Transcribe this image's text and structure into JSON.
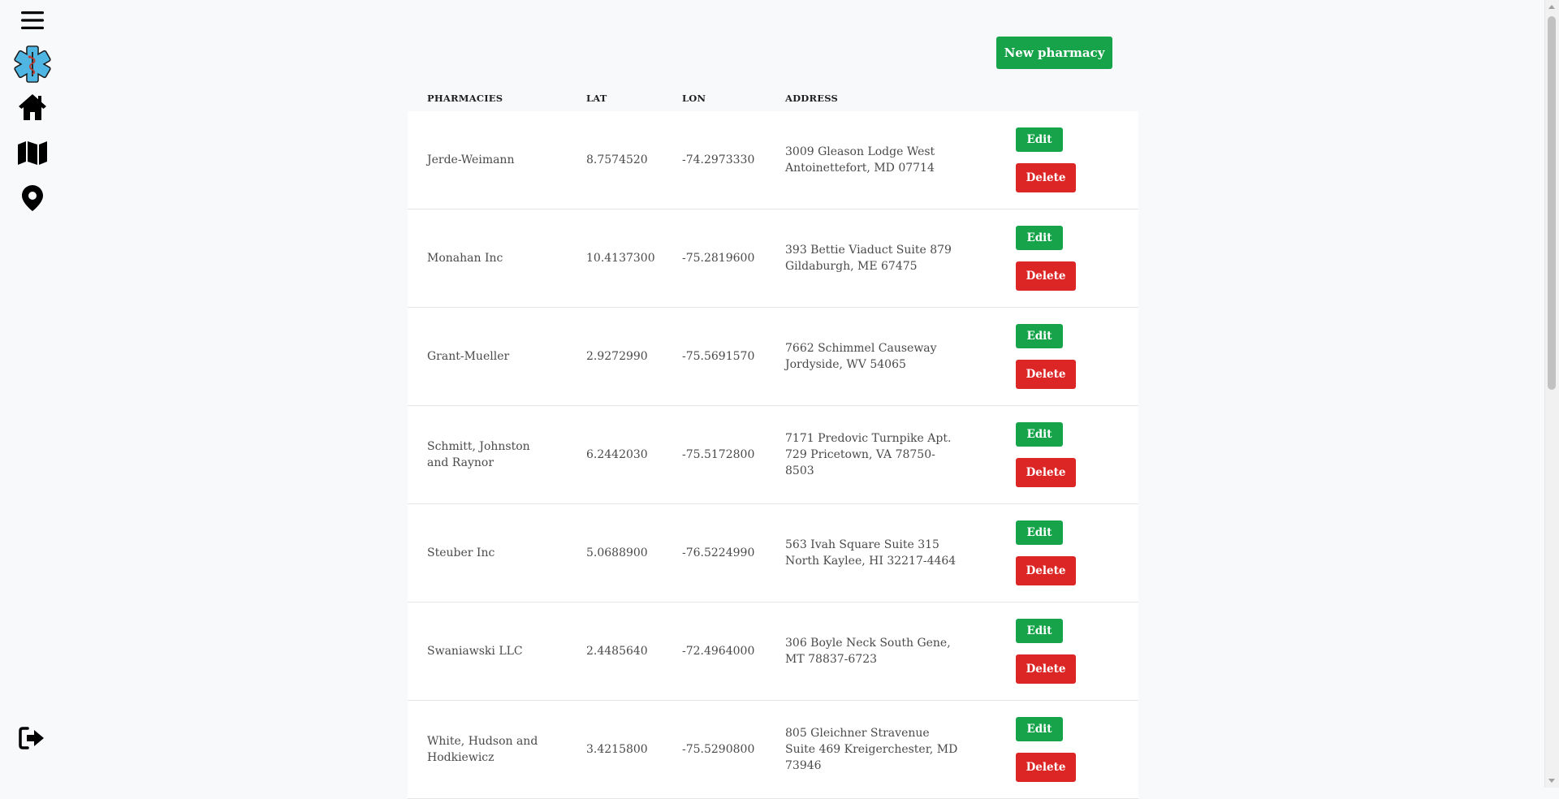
{
  "sidebar": {
    "items": [
      {
        "icon": "menu-icon"
      },
      {
        "icon": "medical-logo-icon"
      },
      {
        "icon": "home-icon"
      },
      {
        "icon": "map-icon"
      },
      {
        "icon": "location-pin-icon"
      },
      {
        "icon": "logout-icon"
      }
    ]
  },
  "toolbar": {
    "new_label": "New pharmacy"
  },
  "table": {
    "headers": {
      "name": "PHARMACIES",
      "lat": "LAT",
      "lon": "LON",
      "address": "ADDRESS"
    },
    "edit_label": "Edit",
    "delete_label": "Delete",
    "rows": [
      {
        "name": "Jerde-Weimann",
        "lat": "8.7574520",
        "lon": "-74.2973330",
        "address": "3009 Gleason Lodge West Antoinettefort, MD 07714"
      },
      {
        "name": "Monahan Inc",
        "lat": "10.4137300",
        "lon": "-75.2819600",
        "address": "393 Bettie Viaduct Suite 879 Gildaburgh, ME 67475"
      },
      {
        "name": "Grant-Mueller",
        "lat": "2.9272990",
        "lon": "-75.5691570",
        "address": "7662 Schimmel Causeway Jordyside, WV 54065"
      },
      {
        "name": "Schmitt, Johnston and Raynor",
        "lat": "6.2442030",
        "lon": "-75.5172800",
        "address": "7171 Predovic Turnpike Apt. 729 Pricetown, VA 78750-8503"
      },
      {
        "name": "Steuber Inc",
        "lat": "5.0688900",
        "lon": "-76.5224990",
        "address": "563 Ivah Square Suite 315 North Kaylee, HI 32217-4464"
      },
      {
        "name": "Swaniawski LLC",
        "lat": "2.4485640",
        "lon": "-72.4964000",
        "address": "306 Boyle Neck South Gene, MT 78837-6723"
      },
      {
        "name": "White, Hudson and Hodkiewicz",
        "lat": "3.4215800",
        "lon": "-75.5290800",
        "address": "805 Gleichner Stravenue Suite 469 Kreigerchester, MD 73946"
      }
    ]
  },
  "colors": {
    "primary": "#16a34a",
    "danger": "#dc2626",
    "logo": "#4fb6e3"
  }
}
